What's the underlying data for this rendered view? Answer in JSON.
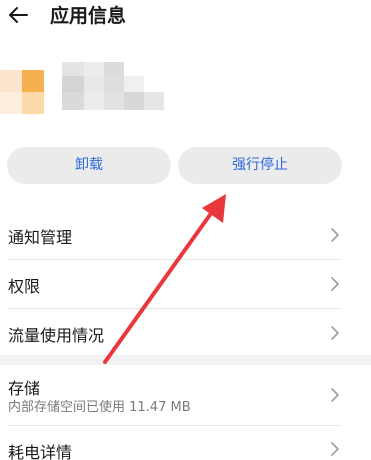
{
  "header": {
    "title": "应用信息",
    "back_icon": "arrow-left-icon"
  },
  "actions": {
    "uninstall_label": "卸载",
    "force_stop_label": "强行停止"
  },
  "settings": {
    "items": [
      {
        "label": "通知管理"
      },
      {
        "label": "权限"
      },
      {
        "label": "流量使用情况"
      }
    ]
  },
  "storage": {
    "label": "存储",
    "detail": "内部存储空间已使用 11.47 MB"
  },
  "power": {
    "label": "耗电详情"
  },
  "colors": {
    "accent": "#2f6ad9",
    "button_bg": "#ebebeb",
    "annotation_arrow": "#e8383b"
  }
}
